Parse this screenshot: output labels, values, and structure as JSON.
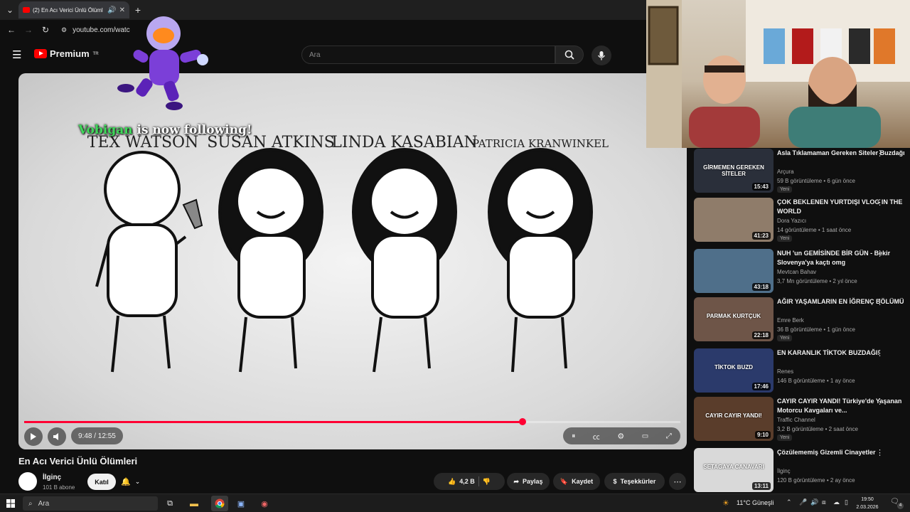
{
  "browser": {
    "tab_title": "(2) En Acı Verici Ünlü Ölüml",
    "url": "youtube.com/watc"
  },
  "youtube": {
    "logo_text": "Premium",
    "region": "TR",
    "search_placeholder": "Ara"
  },
  "player": {
    "current_time": "9:48",
    "duration": "12:55",
    "time_display": "9:48 / 12:55",
    "progress": 0.759,
    "video_names": [
      "TEX WATSON",
      "SUSAN ATKINS",
      "LINDA KASABIAN",
      "PATRICIA KRANWINKEL"
    ]
  },
  "overlay": {
    "follower_name": "Vobigan",
    "follow_text": " is now following!"
  },
  "video": {
    "title": "En Acı Verici Ünlü Ölümleri",
    "channel": "İlginç",
    "subscribers": "101 B abone",
    "join_label": "Katıl",
    "likes": "4,2 B",
    "share_label": "Paylaş",
    "save_label": "Kaydet",
    "thanks_label": "Teşekkürler"
  },
  "recommendations": [
    {
      "title": "Asla Tıklamaman Gereken Siteler Buzdağı",
      "channel": "Arçura",
      "meta": "59 B görüntüleme • 6 gün önce",
      "duration": "15:43",
      "badge": "Yeni",
      "thumb_color": "#2a2f3a",
      "thumb_text": "GİRMEMEN GEREKEN SİTELER"
    },
    {
      "title": "ÇOK BEKLENEN YURTDIŞI VLOG IN THE WORLD",
      "channel": "Dora Yazıcı",
      "meta": "14 görüntüleme • 1 saat önce",
      "duration": "41:23",
      "badge": "Yeni",
      "thumb_color": "#8f7c6a",
      "thumb_text": ""
    },
    {
      "title": "NUH 'un GEMİSİNDE BİR GÜN - Bekir Slovenya'ya kaçtı omg",
      "channel": "Mevtcan Bahav",
      "meta": "3,7 Mn görüntüleme • 2 yıl önce",
      "duration": "43:18",
      "badge": "",
      "thumb_color": "#4f6f8a",
      "thumb_text": ""
    },
    {
      "title": "AĞIR YAŞAMLARIN EN İĞRENÇ BÖLÜMÜ",
      "channel": "Emre Berk",
      "meta": "36 B görüntüleme • 1 gün önce",
      "duration": "22:18",
      "badge": "Yeni",
      "thumb_color": "#6e5548",
      "thumb_text": "PARMAK KURTÇUK"
    },
    {
      "title": "EN KARANLIK TİKTOK BUZDAĞI!",
      "channel": "Renes",
      "meta": "146 B görüntüleme • 1 ay önce",
      "duration": "17:46",
      "badge": "",
      "thumb_color": "#2b3a6b",
      "thumb_text": "TİKTOK BUZD"
    },
    {
      "title": "CAYIR CAYIR YANDI! Türkiye'de Yaşanan Motorcu Kavgaları ve...",
      "channel": "Traffic Channel",
      "meta": "3,2 B görüntüleme • 2 saat önce",
      "duration": "9:10",
      "badge": "Yeni",
      "thumb_color": "#5a3d2b",
      "thumb_text": "CAYIR CAYIR YANDI!"
    },
    {
      "title": "Çözülememiş Gizemli Cinayetler",
      "channel": "İlginç",
      "meta": "120 B görüntüleme • 2 ay önce",
      "duration": "13:11",
      "badge": "",
      "thumb_color": "#d9d9d9",
      "thumb_text": "SETAGAYA CANAVARI"
    }
  ],
  "taskbar": {
    "search_placeholder": "Ara",
    "weather": "11°C  Güneşli",
    "time": "19:50",
    "date": "2.03.2026",
    "notif_count": "4"
  }
}
